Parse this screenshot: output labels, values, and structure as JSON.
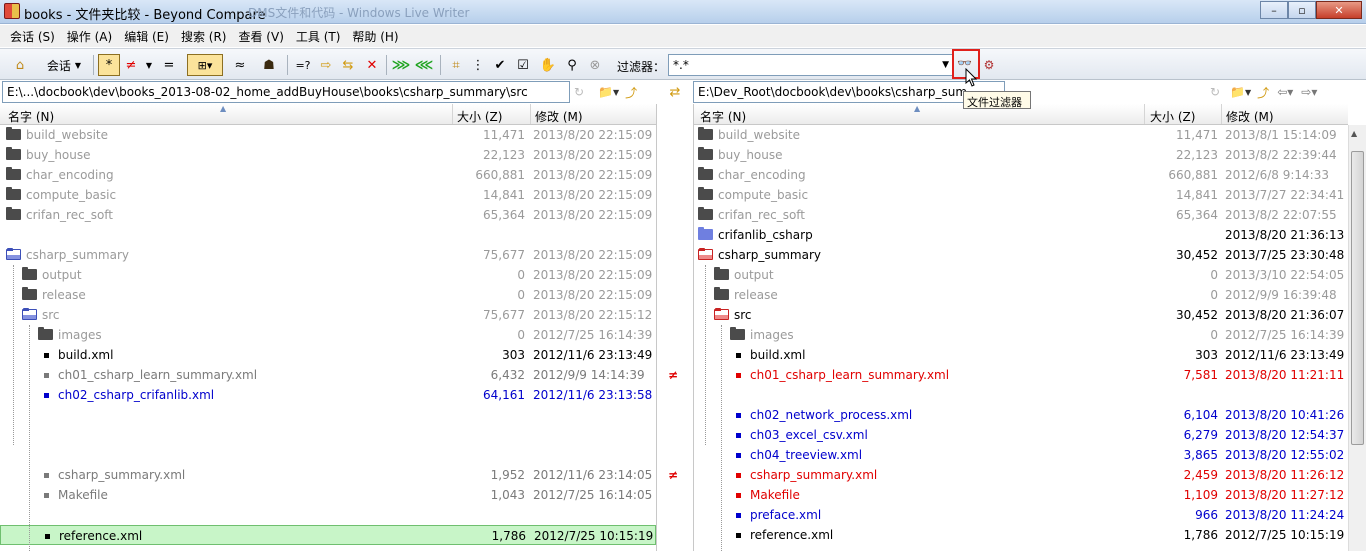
{
  "window": {
    "title": "books - 文件夹比较 - Beyond Compare",
    "ghost": "DMS文件和代码 - Windows Live Writer",
    "minimize": "–",
    "maximize": "▫",
    "close": "✕"
  },
  "menu": [
    "会话 (S)",
    "操作 (A)",
    "编辑 (E)",
    "搜索 (R)",
    "查看 (V)",
    "工具 (T)",
    "帮助 (H)"
  ],
  "toolbar": {
    "sessions": "会话",
    "filter_label": "过滤器：",
    "filter_value": "*.*",
    "tooltip": "文件过滤器"
  },
  "icons": {
    "home": "⌂",
    "all": "*",
    "diff": "≠",
    "same": "=",
    "minor": "≈",
    "compare": "=?",
    "copy_right": "⇨",
    "swap": "⇆",
    "del": "✕",
    "sync_r": "⋙",
    "sync_l": "⋘",
    "tree": "⋮",
    "check": "✔",
    "gray_x": "⊗"
  },
  "left": {
    "path": "E:\\...\\docbook\\dev\\books_2013-08-02_home_addBuyHouse\\books\\csharp_summary\\src",
    "headers": {
      "name": "名字 (N)",
      "size": "大小 (Z)",
      "date": "修改 (M)"
    },
    "rows": [
      {
        "name": "build_website",
        "size": "11,471",
        "date": "2013/8/20 22:15:09",
        "kind": "folder",
        "lvl": 0,
        "cls": "gray"
      },
      {
        "name": "buy_house",
        "size": "22,123",
        "date": "2013/8/20 22:15:09",
        "kind": "folder",
        "lvl": 0,
        "cls": "gray"
      },
      {
        "name": "char_encoding",
        "size": "660,881",
        "date": "2013/8/20 22:15:09",
        "kind": "folder",
        "lvl": 0,
        "cls": "gray"
      },
      {
        "name": "compute_basic",
        "size": "14,841",
        "date": "2013/8/20 22:15:09",
        "kind": "folder",
        "lvl": 0,
        "cls": "gray"
      },
      {
        "name": "crifan_rec_soft",
        "size": "65,364",
        "date": "2013/8/20 22:15:09",
        "kind": "folder",
        "lvl": 0,
        "cls": "gray"
      },
      {
        "name": "",
        "size": "",
        "date": "",
        "kind": "blank",
        "lvl": 0,
        "cls": "gray"
      },
      {
        "name": "csharp_summary",
        "size": "75,677",
        "date": "2013/8/20 22:15:09",
        "kind": "openfolder",
        "lvl": 0,
        "cls": "gray"
      },
      {
        "name": "output",
        "size": "0",
        "date": "2013/8/20 22:15:09",
        "kind": "folder",
        "lvl": 1,
        "cls": "gray"
      },
      {
        "name": "release",
        "size": "0",
        "date": "2013/8/20 22:15:09",
        "kind": "folder",
        "lvl": 1,
        "cls": "gray"
      },
      {
        "name": "src",
        "size": "75,677",
        "date": "2013/8/20 22:15:12",
        "kind": "openfolder",
        "lvl": 1,
        "cls": "gray"
      },
      {
        "name": "images",
        "size": "0",
        "date": "2012/7/25 16:14:39",
        "kind": "folder",
        "lvl": 2,
        "cls": "gray"
      },
      {
        "name": "build.xml",
        "size": "303",
        "date": "2012/11/6 23:13:49",
        "kind": "file",
        "lvl": 2,
        "cls": "c-black"
      },
      {
        "name": "ch01_csharp_learn_summary.xml",
        "size": "6,432",
        "date": "2012/9/9 14:14:39",
        "kind": "file",
        "lvl": 2,
        "cls": "c-dgray"
      },
      {
        "name": "ch02_csharp_crifanlib.xml",
        "size": "64,161",
        "date": "2012/11/6 23:13:58",
        "kind": "file",
        "lvl": 2,
        "cls": "c-blue"
      },
      {
        "name": "",
        "size": "",
        "date": "",
        "kind": "blank",
        "lvl": 2,
        "cls": "gray"
      },
      {
        "name": "",
        "size": "",
        "date": "",
        "kind": "blank",
        "lvl": 2,
        "cls": "gray"
      },
      {
        "name": "",
        "size": "",
        "date": "",
        "kind": "blank",
        "lvl": 2,
        "cls": "gray"
      },
      {
        "name": "csharp_summary.xml",
        "size": "1,952",
        "date": "2012/11/6 23:14:05",
        "kind": "file",
        "lvl": 2,
        "cls": "c-dgray"
      },
      {
        "name": "Makefile",
        "size": "1,043",
        "date": "2012/7/25 16:14:05",
        "kind": "file",
        "lvl": 2,
        "cls": "c-dgray"
      },
      {
        "name": "",
        "size": "",
        "date": "",
        "kind": "blank",
        "lvl": 2,
        "cls": "gray"
      },
      {
        "name": "reference.xml",
        "size": "1,786",
        "date": "2012/7/25 10:15:19",
        "kind": "file",
        "lvl": 2,
        "cls": "c-black",
        "hl": true
      }
    ]
  },
  "right": {
    "path": "E:\\Dev_Root\\docbook\\dev\\books\\csharp_sum",
    "headers": {
      "name": "名字 (N)",
      "size": "大小 (Z)",
      "date": "修改 (M)"
    },
    "rows": [
      {
        "name": "build_website",
        "size": "11,471",
        "date": "2013/8/1 15:14:09",
        "kind": "folder",
        "lvl": 0,
        "cls": "gray"
      },
      {
        "name": "buy_house",
        "size": "22,123",
        "date": "2013/8/2 22:39:44",
        "kind": "folder",
        "lvl": 0,
        "cls": "gray"
      },
      {
        "name": "char_encoding",
        "size": "660,881",
        "date": "2012/6/8 9:14:33",
        "kind": "folder",
        "lvl": 0,
        "cls": "gray"
      },
      {
        "name": "compute_basic",
        "size": "14,841",
        "date": "2013/7/27 22:34:41",
        "kind": "folder",
        "lvl": 0,
        "cls": "gray"
      },
      {
        "name": "crifan_rec_soft",
        "size": "65,364",
        "date": "2013/8/2 22:07:55",
        "kind": "folder",
        "lvl": 0,
        "cls": "gray"
      },
      {
        "name": "crifanlib_csharp",
        "size": "",
        "date": "2013/8/20 21:36:13",
        "kind": "bluefolder",
        "lvl": 0,
        "cls": "c-black"
      },
      {
        "name": "csharp_summary",
        "size": "30,452",
        "date": "2013/7/25 23:30:48",
        "kind": "redfolder",
        "lvl": 0,
        "cls": "c-black"
      },
      {
        "name": "output",
        "size": "0",
        "date": "2013/3/10 22:54:05",
        "kind": "folder",
        "lvl": 1,
        "cls": "gray"
      },
      {
        "name": "release",
        "size": "0",
        "date": "2012/9/9 16:39:48",
        "kind": "folder",
        "lvl": 1,
        "cls": "gray"
      },
      {
        "name": "src",
        "size": "30,452",
        "date": "2013/8/20 21:36:07",
        "kind": "redfolder",
        "lvl": 1,
        "cls": "c-black"
      },
      {
        "name": "images",
        "size": "0",
        "date": "2012/7/25 16:14:39",
        "kind": "folder",
        "lvl": 2,
        "cls": "gray"
      },
      {
        "name": "build.xml",
        "size": "303",
        "date": "2012/11/6 23:13:49",
        "kind": "file",
        "lvl": 2,
        "cls": "c-black"
      },
      {
        "name": "ch01_csharp_learn_summary.xml",
        "size": "7,581",
        "date": "2013/8/20 11:21:11",
        "kind": "file",
        "lvl": 2,
        "cls": "c-red"
      },
      {
        "name": "",
        "size": "",
        "date": "",
        "kind": "blank",
        "lvl": 2,
        "cls": "gray"
      },
      {
        "name": "ch02_network_process.xml",
        "size": "6,104",
        "date": "2013/8/20 10:41:26",
        "kind": "file",
        "lvl": 2,
        "cls": "c-blue"
      },
      {
        "name": "ch03_excel_csv.xml",
        "size": "6,279",
        "date": "2013/8/20 12:54:37",
        "kind": "file",
        "lvl": 2,
        "cls": "c-blue"
      },
      {
        "name": "ch04_treeview.xml",
        "size": "3,865",
        "date": "2013/8/20 12:55:02",
        "kind": "file",
        "lvl": 2,
        "cls": "c-blue"
      },
      {
        "name": "csharp_summary.xml",
        "size": "2,459",
        "date": "2013/8/20 11:26:12",
        "kind": "file",
        "lvl": 2,
        "cls": "c-red"
      },
      {
        "name": "Makefile",
        "size": "1,109",
        "date": "2013/8/20 11:27:12",
        "kind": "file",
        "lvl": 2,
        "cls": "c-red"
      },
      {
        "name": "preface.xml",
        "size": "966",
        "date": "2013/8/20 11:24:24",
        "kind": "file",
        "lvl": 2,
        "cls": "c-blue"
      },
      {
        "name": "reference.xml",
        "size": "1,786",
        "date": "2012/7/25 10:15:19",
        "kind": "file",
        "lvl": 2,
        "cls": "c-black"
      }
    ]
  },
  "gutter": {
    "marker": "≠",
    "rows": [
      12,
      17
    ]
  }
}
